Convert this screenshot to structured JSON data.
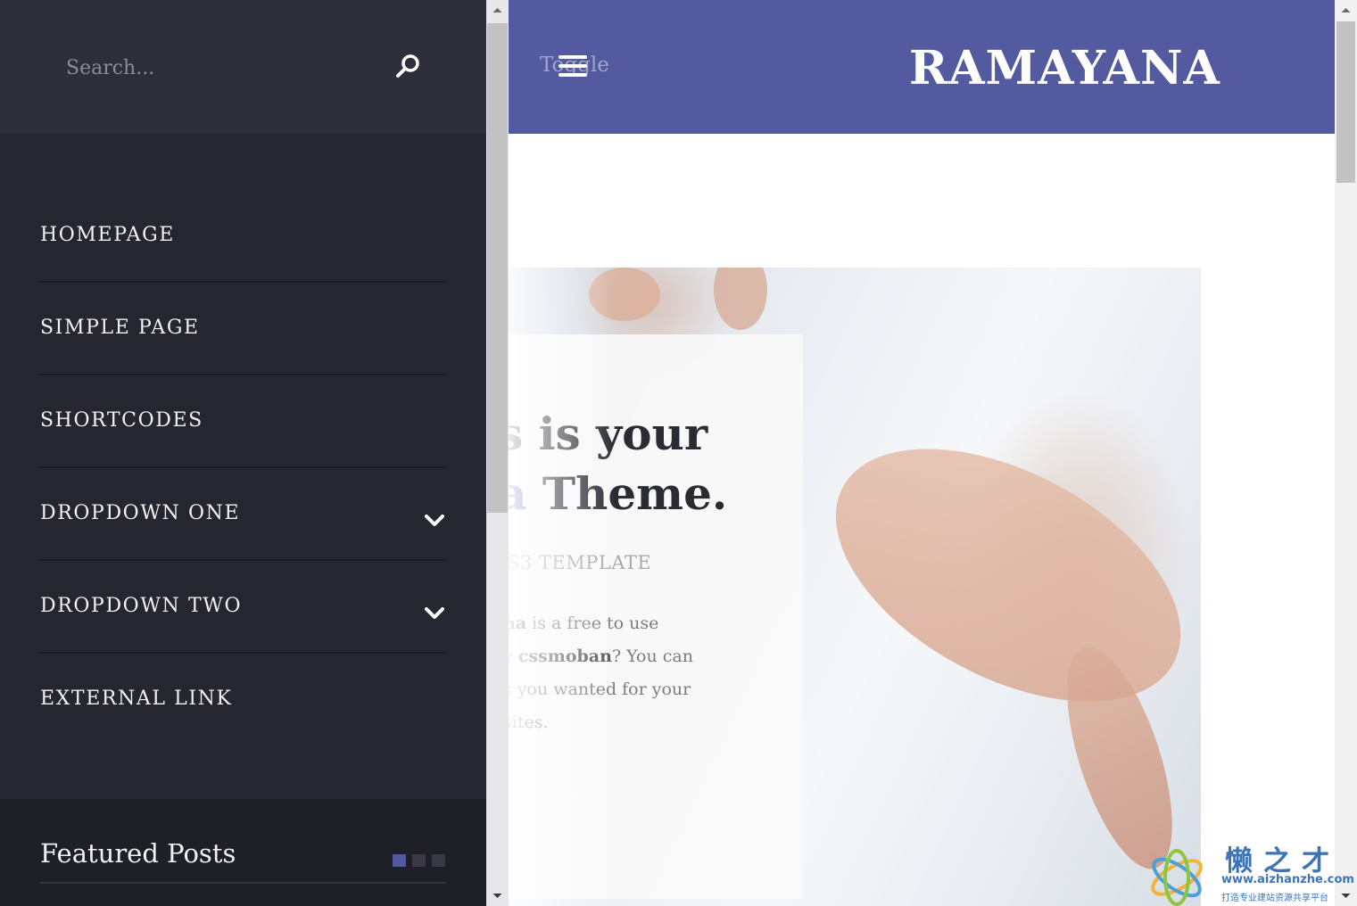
{
  "sidebar": {
    "search": {
      "placeholder": "Search...",
      "value": ""
    },
    "nav": [
      {
        "label": "HOMEPAGE",
        "has_dropdown": false
      },
      {
        "label": "SIMPLE PAGE",
        "has_dropdown": false
      },
      {
        "label": "SHORTCODES",
        "has_dropdown": false
      },
      {
        "label": "DROPDOWN ONE",
        "has_dropdown": true
      },
      {
        "label": "DROPDOWN TWO",
        "has_dropdown": true
      },
      {
        "label": "EXTERNAL LINK",
        "has_dropdown": false
      }
    ],
    "featured": {
      "title": "Featured Posts",
      "dots": 3,
      "active_dot": 0
    }
  },
  "header": {
    "toggle_text": "Toggle",
    "site_title": "RAMAYANA"
  },
  "hero": {
    "heading_line1": "s is your",
    "heading_line2_accent": "a",
    "heading_line2_rest": " Theme.",
    "subtitle": "S3 TEMPLATE",
    "text": {
      "line1_bold": "na",
      "line1_rest": " is a free to use",
      "line2_pre": "y ",
      "line2_bold": "cssmoban",
      "line2_rest": "? You can",
      "line3": "s you wanted for your",
      "line4": "sites."
    }
  },
  "watermark": {
    "cjk": "懒之才",
    "url": "www.aizhanzhe.com",
    "slogan": "打造专业建站资源共享平台"
  },
  "colors": {
    "sidebar_bg": "#25262f",
    "search_bg": "#2e2f3a",
    "featured_bg": "#1f2027",
    "accent": "#52599f",
    "header_bg": "#535aa0",
    "dot_inactive": "#383944"
  },
  "icons": {
    "search": "search-icon",
    "menu": "hamburger-icon",
    "dropdown": "chevron-down-icon"
  }
}
